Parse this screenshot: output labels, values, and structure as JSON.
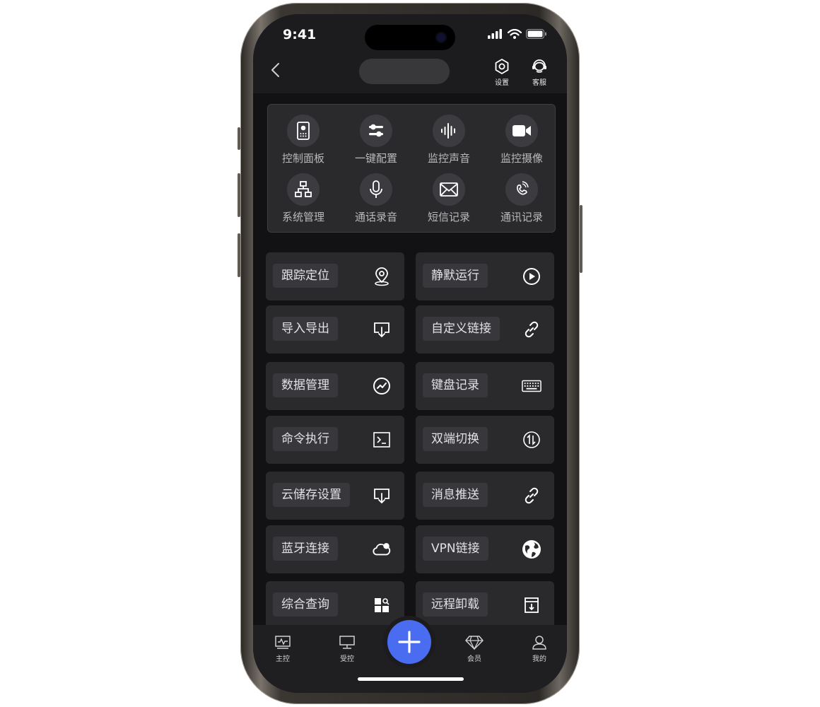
{
  "status_bar": {
    "time": "9:41"
  },
  "nav": {
    "settings_label": "设置",
    "support_label": "客服"
  },
  "grid": [
    {
      "label": "控制面板",
      "icon": "control-panel-icon"
    },
    {
      "label": "一键配置",
      "icon": "sliders-icon"
    },
    {
      "label": "监控声音",
      "icon": "sound-wave-icon"
    },
    {
      "label": "监控摄像",
      "icon": "video-camera-icon"
    },
    {
      "label": "系统管理",
      "icon": "network-icon"
    },
    {
      "label": "通话录音",
      "icon": "microphone-icon"
    },
    {
      "label": "短信记录",
      "icon": "envelope-icon"
    },
    {
      "label": "通讯记录",
      "icon": "phone-icon"
    }
  ],
  "tiles": [
    {
      "label": "跟踪定位",
      "icon": "location-pin-icon"
    },
    {
      "label": "静默运行",
      "icon": "play-circle-icon"
    },
    {
      "label": "导入导出",
      "icon": "download-tray-icon"
    },
    {
      "label": "自定义链接",
      "icon": "link-icon"
    },
    {
      "label": "数据管理",
      "icon": "trend-circle-icon"
    },
    {
      "label": "键盘记录",
      "icon": "keyboard-icon"
    },
    {
      "label": "命令执行",
      "icon": "terminal-icon"
    },
    {
      "label": "双端切换",
      "icon": "switch-circle-icon"
    },
    {
      "label": "云储存设置",
      "icon": "download-tray-icon"
    },
    {
      "label": "消息推送",
      "icon": "link-icon"
    },
    {
      "label": "蓝牙连接",
      "icon": "cloud-icon"
    },
    {
      "label": "VPN链接",
      "icon": "globe-icon"
    },
    {
      "label": "综合查询",
      "icon": "dashboard-search-icon"
    },
    {
      "label": "远程卸载",
      "icon": "archive-download-icon"
    }
  ],
  "tabbar": [
    {
      "label": "主控",
      "icon": "monitor-pulse-icon"
    },
    {
      "label": "受控",
      "icon": "desktop-icon"
    },
    {
      "label": "会员",
      "icon": "diamond-icon"
    },
    {
      "label": "我的",
      "icon": "user-icon"
    }
  ]
}
